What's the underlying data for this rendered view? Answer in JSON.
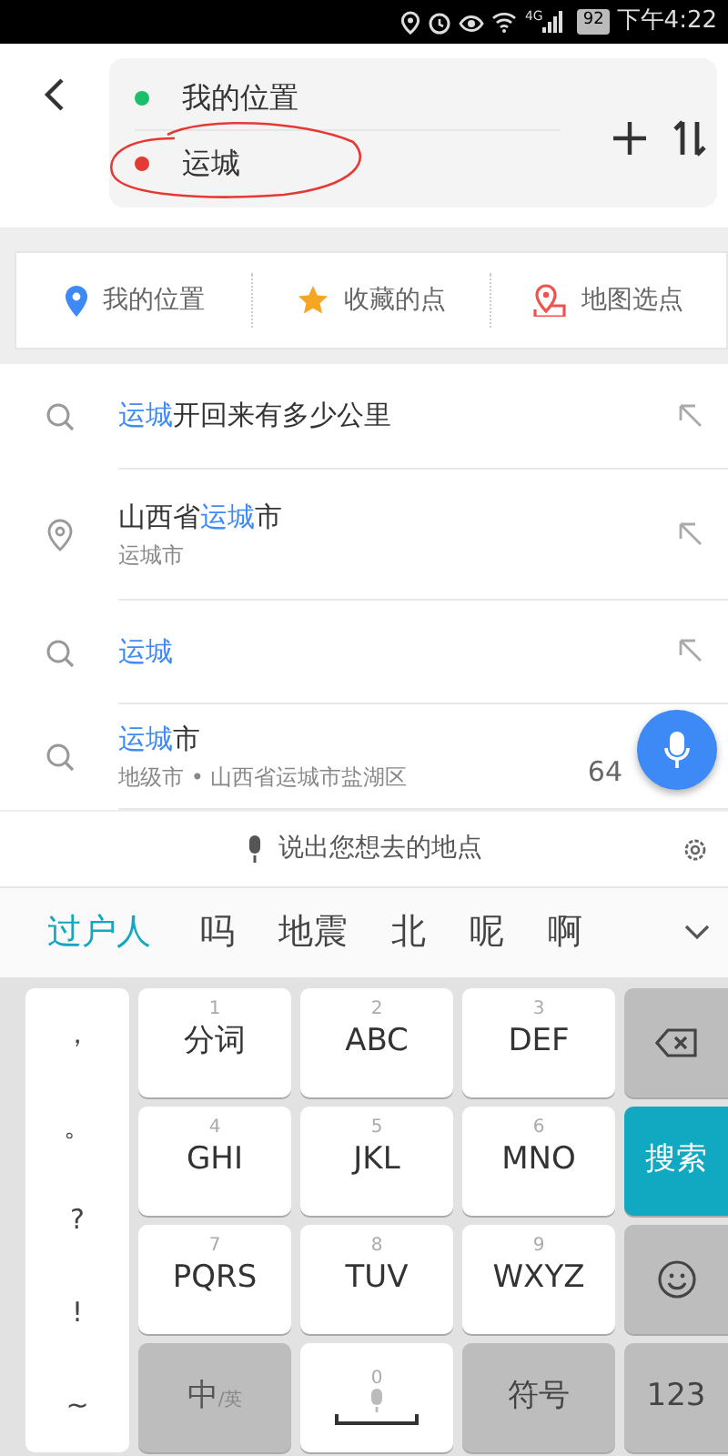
{
  "status_bar": {
    "network": "4G",
    "battery": "92",
    "time": "下午4:22"
  },
  "route": {
    "stops": [
      {
        "text": "我的位置",
        "color": "#1bbf6b"
      },
      {
        "text": "运城",
        "color": "#e53935"
      }
    ]
  },
  "quick_actions": [
    {
      "kind": "pin",
      "label": "我的位置"
    },
    {
      "kind": "star",
      "label": "收藏的点"
    },
    {
      "kind": "map",
      "label": "地图选点"
    }
  ],
  "results": [
    {
      "kind": "search",
      "title": [
        {
          "text": "运城",
          "highlight": true
        },
        {
          "text": "开回来有多少公里",
          "highlight": false
        }
      ],
      "fill_arrow": true
    },
    {
      "kind": "place",
      "title": [
        {
          "text": "山西省",
          "highlight": false
        },
        {
          "text": "运城",
          "highlight": true
        },
        {
          "text": "市",
          "highlight": false
        }
      ],
      "subtitle": "运城市",
      "fill_arrow": true
    },
    {
      "kind": "search",
      "title": [
        {
          "text": "运城",
          "highlight": true
        }
      ],
      "fill_arrow": true
    },
    {
      "kind": "search",
      "title": [
        {
          "text": "运城",
          "highlight": true
        },
        {
          "text": "市",
          "highlight": false
        }
      ],
      "subtitle": "地级市 • 山西省运城市盐湖区",
      "distance": "64",
      "fill_arrow": false
    }
  ],
  "voice_hint": "说出您想去的地点",
  "candidates": [
    {
      "text": "过户人",
      "selected": true
    },
    {
      "text": "吗",
      "selected": false
    },
    {
      "text": "地震",
      "selected": false
    },
    {
      "text": "北",
      "selected": false
    },
    {
      "text": "呢",
      "selected": false
    },
    {
      "text": "啊",
      "selected": false
    }
  ],
  "keyboard": {
    "side_keys": [
      "，",
      "。",
      "?",
      "!",
      "~"
    ],
    "keys": [
      {
        "kind": "letters",
        "digit": "1",
        "label": "分词"
      },
      {
        "kind": "letters",
        "digit": "2",
        "label": "ABC"
      },
      {
        "kind": "letters",
        "digit": "3",
        "label": "DEF"
      },
      {
        "kind": "backspace"
      },
      {
        "kind": "letters",
        "digit": "4",
        "label": "GHI"
      },
      {
        "kind": "letters",
        "digit": "5",
        "label": "JKL"
      },
      {
        "kind": "letters",
        "digit": "6",
        "label": "MNO"
      },
      {
        "kind": "primary",
        "label": "搜索"
      },
      {
        "kind": "letters",
        "digit": "7",
        "label": "PQRS"
      },
      {
        "kind": "letters",
        "digit": "8",
        "label": "TUV"
      },
      {
        "kind": "letters",
        "digit": "9",
        "label": "WXYZ"
      },
      {
        "kind": "emoji"
      },
      {
        "kind": "function",
        "label": "中$_{/英}$"
      },
      {
        "kind": "space",
        "digit": "0"
      },
      {
        "kind": "function",
        "label": "符号"
      },
      {
        "kind": "function",
        "label": "123"
      }
    ]
  }
}
